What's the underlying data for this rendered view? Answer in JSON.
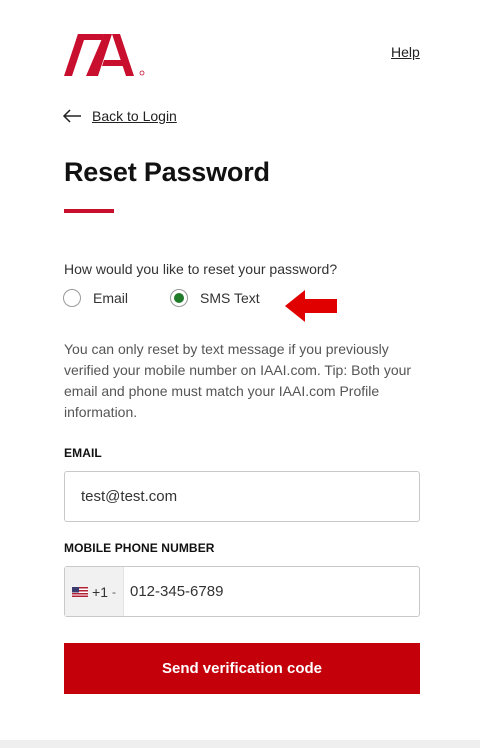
{
  "header": {
    "logo_alt": "IAA",
    "help_label": "Help"
  },
  "nav": {
    "back_label": "Back to Login"
  },
  "page": {
    "title": "Reset Password",
    "question": "How would you like to reset your password?",
    "options": [
      {
        "label": "Email",
        "selected": false
      },
      {
        "label": "SMS Text",
        "selected": true
      }
    ],
    "info_text": "You can only reset by text message if you previously verified your mobile number on IAAI.com. Tip: Both your email and phone must match your IAAI.com Profile information."
  },
  "form": {
    "email_label": "EMAIL",
    "email_value": "test@test.com",
    "phone_label": "MOBILE PHONE NUMBER",
    "country_code": "+1",
    "country_chevron": "-",
    "phone_value": "012-345-6789",
    "submit_label": "Send verification code"
  },
  "colors": {
    "brand_red": "#c8102e",
    "button_red": "#c4000b",
    "radio_selected": "#1f7a2a",
    "annotation_red": "#e00000"
  },
  "icons": {
    "back": "arrow-left-icon",
    "annotation": "red-arrow-icon",
    "flag": "us-flag-icon"
  }
}
